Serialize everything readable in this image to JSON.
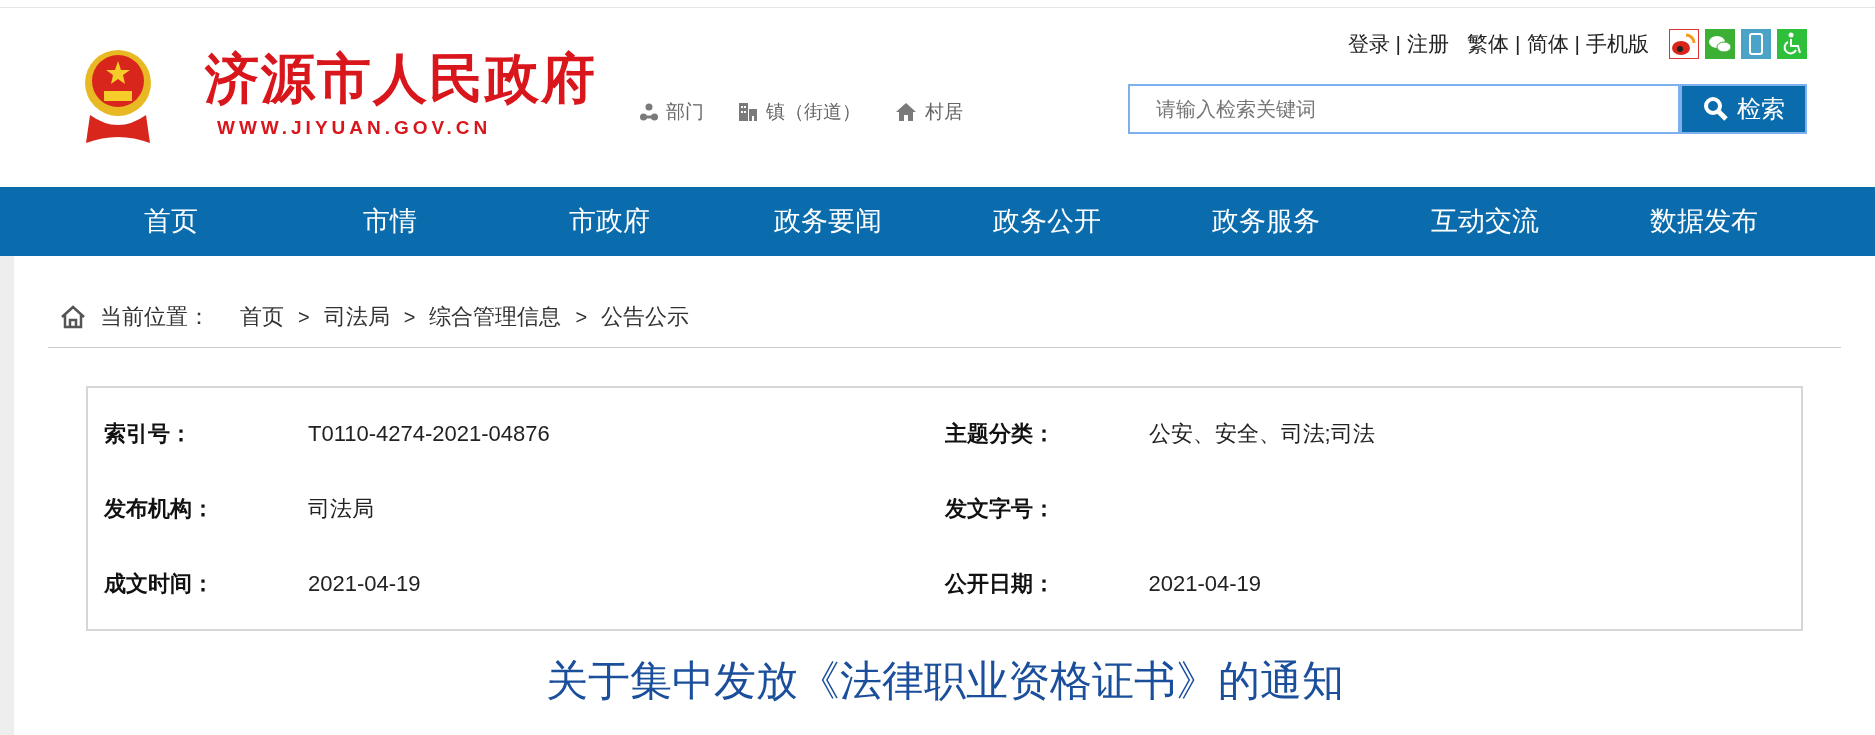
{
  "header": {
    "site_name": "济源市人民政府",
    "site_url": "WWW.JIYUAN.GOV.CN",
    "quick_links": [
      {
        "kind": "department",
        "label": "部门"
      },
      {
        "kind": "town",
        "label": "镇（街道）"
      },
      {
        "kind": "village",
        "label": "村居"
      }
    ],
    "top_links": [
      {
        "kind": "link",
        "label": "登录"
      },
      {
        "kind": "separator",
        "label": "|"
      },
      {
        "kind": "link",
        "label": "注册"
      },
      {
        "kind": "link",
        "label": "繁体"
      },
      {
        "kind": "separator",
        "label": "|"
      },
      {
        "kind": "link",
        "label": "简体"
      },
      {
        "kind": "separator",
        "label": "|"
      },
      {
        "kind": "link",
        "label": "手机版"
      }
    ],
    "search": {
      "placeholder": "请输入检索关键词",
      "button": "检索"
    }
  },
  "nav": [
    "首页",
    "市情",
    "市政府",
    "政务要闻",
    "政务公开",
    "政务服务",
    "互动交流",
    "数据发布"
  ],
  "breadcrumb": {
    "label": "当前位置：",
    "items": [
      {
        "kind": "link",
        "label": "首页"
      },
      {
        "kind": "separator",
        "label": ">"
      },
      {
        "kind": "link",
        "label": "司法局"
      },
      {
        "kind": "separator",
        "label": ">"
      },
      {
        "kind": "link",
        "label": "综合管理信息"
      },
      {
        "kind": "separator",
        "label": ">"
      },
      {
        "kind": "link",
        "label": "公告公示"
      }
    ]
  },
  "info": [
    {
      "label": "索引号：",
      "value": "T0110-4274-2021-04876"
    },
    {
      "label": "主题分类：",
      "value": "公安、安全、司法;司法"
    },
    {
      "label": "发布机构：",
      "value": "司法局"
    },
    {
      "label": "发文字号："
    },
    {
      "label": "成文时间：",
      "value": "2021-04-19"
    },
    {
      "label": "公开日期：",
      "value": "2021-04-19"
    }
  ],
  "article_title": "关于集中发放《法律职业资格证书》的通知"
}
